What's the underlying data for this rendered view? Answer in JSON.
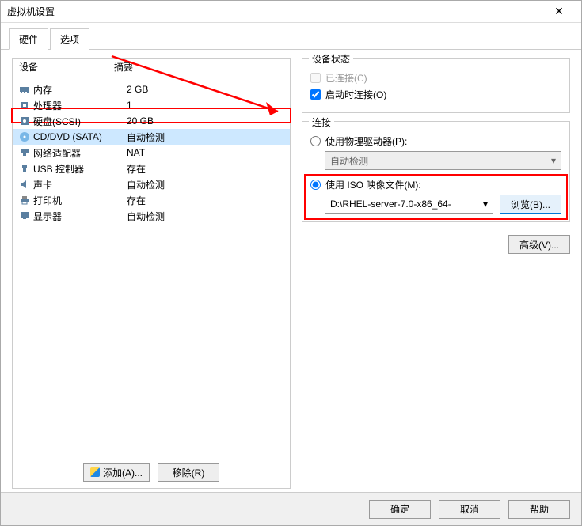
{
  "window": {
    "title": "虚拟机设置"
  },
  "tabs": {
    "hardware": "硬件",
    "options": "选项"
  },
  "devlist": {
    "header_device": "设备",
    "header_summary": "摘要",
    "items": [
      {
        "name": "内存",
        "summary": "2 GB",
        "icon": "memory"
      },
      {
        "name": "处理器",
        "summary": "1",
        "icon": "cpu"
      },
      {
        "name": "硬盘(SCSI)",
        "summary": "20 GB",
        "icon": "disk"
      },
      {
        "name": "CD/DVD (SATA)",
        "summary": "自动检测",
        "icon": "cd"
      },
      {
        "name": "网络适配器",
        "summary": "NAT",
        "icon": "network"
      },
      {
        "name": "USB 控制器",
        "summary": "存在",
        "icon": "usb"
      },
      {
        "name": "声卡",
        "summary": "自动检测",
        "icon": "sound"
      },
      {
        "name": "打印机",
        "summary": "存在",
        "icon": "printer"
      },
      {
        "name": "显示器",
        "summary": "自动检测",
        "icon": "display"
      }
    ]
  },
  "buttons": {
    "add": "添加(A)...",
    "remove": "移除(R)",
    "ok": "确定",
    "cancel": "取消",
    "help": "帮助",
    "advanced": "高级(V)...",
    "browse": "浏览(B)..."
  },
  "right": {
    "status_title": "设备状态",
    "connected": "已连接(C)",
    "connect_at_poweron": "启动时连接(O)",
    "connection_title": "连接",
    "use_physical": "使用物理驱动器(P):",
    "physical_value": "自动检测",
    "use_iso": "使用 ISO 映像文件(M):",
    "iso_value": "D:\\RHEL-server-7.0-x86_64-"
  }
}
